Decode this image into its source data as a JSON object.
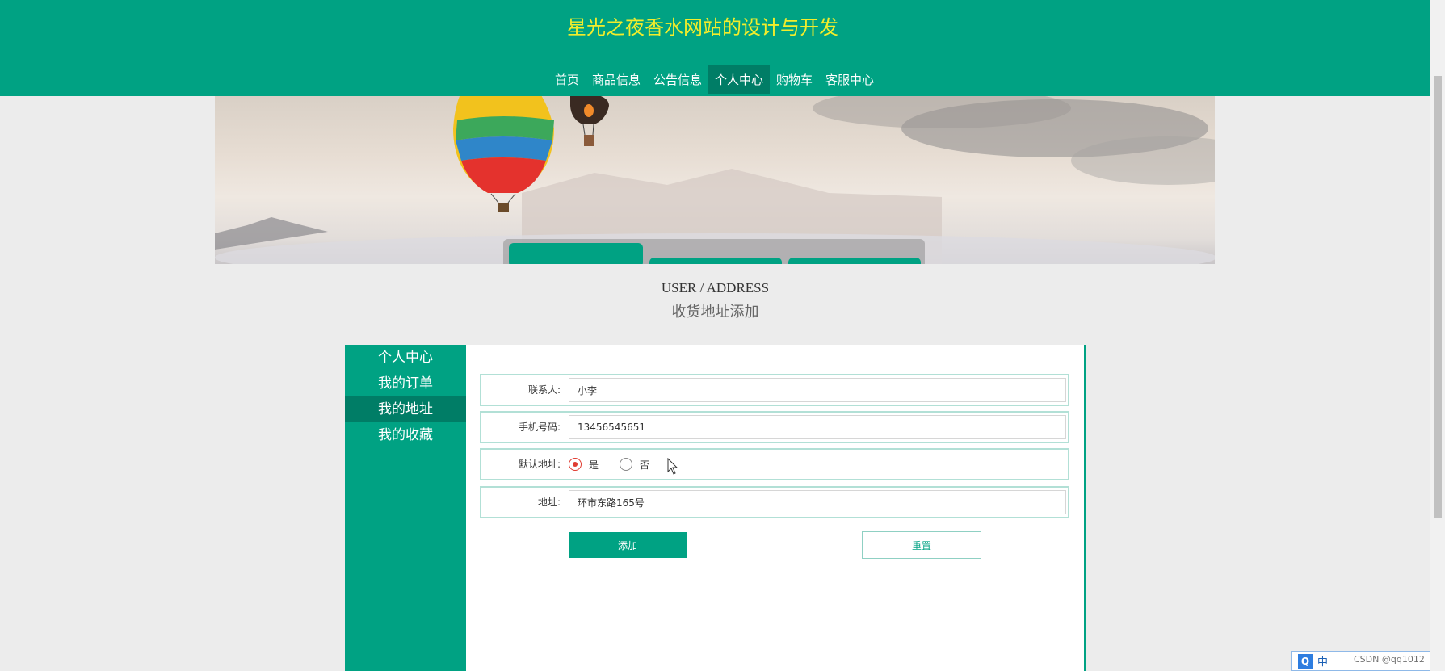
{
  "header": {
    "site_title": "星光之夜香水网站的设计与开发",
    "nav": [
      {
        "label": "首页",
        "active": false
      },
      {
        "label": "商品信息",
        "active": false
      },
      {
        "label": "公告信息",
        "active": false
      },
      {
        "label": "个人中心",
        "active": true
      },
      {
        "label": "购物车",
        "active": false
      },
      {
        "label": "客服中心",
        "active": false
      }
    ]
  },
  "page": {
    "heading_en": "USER / ADDRESS",
    "heading_cn": "收货地址添加"
  },
  "sidebar": {
    "items": [
      {
        "label": "个人中心",
        "active": false
      },
      {
        "label": "我的订单",
        "active": false
      },
      {
        "label": "我的地址",
        "active": true
      },
      {
        "label": "我的收藏",
        "active": false
      }
    ]
  },
  "form": {
    "contact": {
      "label": "联系人:",
      "value": "小李"
    },
    "phone": {
      "label": "手机号码:",
      "value": "13456545651"
    },
    "default_address": {
      "label": "默认地址:",
      "options": [
        {
          "label": "是",
          "checked": true
        },
        {
          "label": "否",
          "checked": false
        }
      ]
    },
    "address": {
      "label": "地址:",
      "value": "环市东路165号"
    },
    "add_button": "添加",
    "reset_button": "重置"
  },
  "ime": {
    "logo": "Q",
    "lang": "中"
  },
  "watermark": "CSDN @qq1012",
  "colors": {
    "primary": "#00a283",
    "active": "#007d66",
    "title": "#f3ed2b"
  }
}
